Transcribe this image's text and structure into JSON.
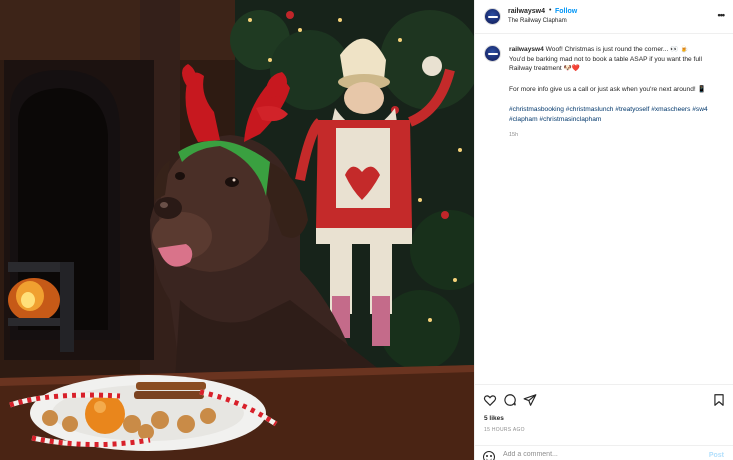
{
  "post": {
    "username": "railwaysw4",
    "separator": "•",
    "follow_label": "Follow",
    "location": "The Railway Clapham",
    "more_icon": "more-options-icon"
  },
  "caption": {
    "username": "railwaysw4",
    "line1": "Woof! Christmas is just round the corner... 👀 🍺",
    "line2": "You'd be barking mad not to book a table ASAP if you want the full",
    "line3": "Railway treatment 🐶❤️",
    "line4": "For more info give us a call or just ask when you're next around! 📱",
    "hashtags": "#christmasbooking #christmaslunch #treatyoself #xmascheers #sw4 #clapham #christmasinclapham",
    "time": "15h"
  },
  "actions": {
    "icons": [
      "heart-icon",
      "comment-icon",
      "share-icon",
      "bookmark-icon"
    ],
    "likes": "5 likes",
    "date": "15 HOURS AGO"
  },
  "comment": {
    "placeholder": "Add a comment...",
    "post_label": "Post"
  },
  "colors": {
    "link_blue": "#0095f6",
    "hashtag_blue": "#00376b",
    "muted": "#8e8e8e",
    "text": "#262626"
  }
}
